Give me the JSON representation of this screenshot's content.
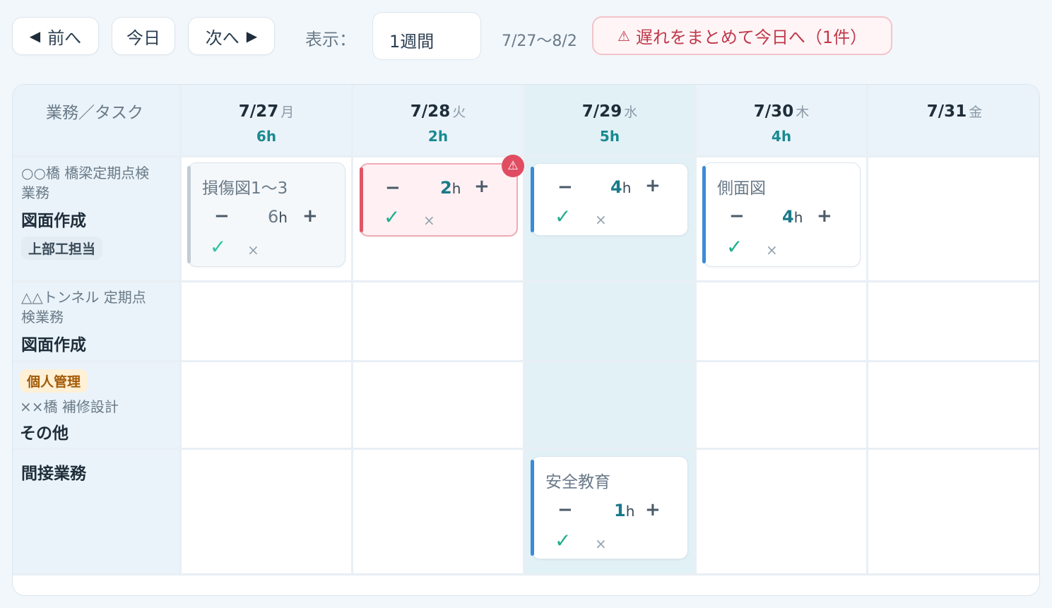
{
  "toolbar": {
    "prev_label": "前へ",
    "prev_arrow": "◀",
    "today_label": "今日",
    "next_label": "次へ",
    "next_arrow": "▶",
    "view_label": "表示：",
    "view_value": "1週間",
    "range": "7/27〜8/2",
    "late_icon": "⚠",
    "late_label": "遅れをまとめて今日へ（1件）"
  },
  "grid": {
    "corner_label": "業務／タスク",
    "days": [
      {
        "date": "7/27",
        "dow": "月",
        "hours": "6h"
      },
      {
        "date": "7/28",
        "dow": "火",
        "hours": "2h"
      },
      {
        "date": "7/29",
        "dow": "水",
        "hours": "5h"
      },
      {
        "date": "7/30",
        "dow": "木",
        "hours": "4h"
      },
      {
        "date": "7/31",
        "dow": "金",
        "hours": ""
      }
    ],
    "rows": [
      {
        "project": "○○橋 橋梁定期点検業務",
        "project_l1": "○○橋 橋梁定期点検",
        "project_l2": "業務",
        "task": "図面作成",
        "chip": "上部工担当"
      },
      {
        "project_l1": "△△トンネル 定期点",
        "project_l2": "検業務",
        "task": "図面作成"
      },
      {
        "chip": "個人管理",
        "project_l1": "××橋 補修設計",
        "task": "その他"
      },
      {
        "task": "間接業務"
      }
    ]
  },
  "cards": {
    "c1": {
      "title": "損傷図1〜3",
      "hours": "6",
      "unit": "h"
    },
    "c2": {
      "hours": "2",
      "unit": "h",
      "badge": "⚠"
    },
    "c3": {
      "hours": "4",
      "unit": "h"
    },
    "c4": {
      "title": "側面図",
      "hours": "4",
      "unit": "h"
    },
    "c5": {
      "title": "安全教育",
      "hours": "1",
      "unit": "h"
    }
  },
  "glyphs": {
    "minus": "−",
    "plus": "+",
    "check": "✓",
    "cross": "×"
  },
  "colors": {
    "accent_teal": "#1a8a91",
    "warn_red": "#e05568",
    "card_blue": "#3b8bd6",
    "check_green": "#1fae8e"
  }
}
